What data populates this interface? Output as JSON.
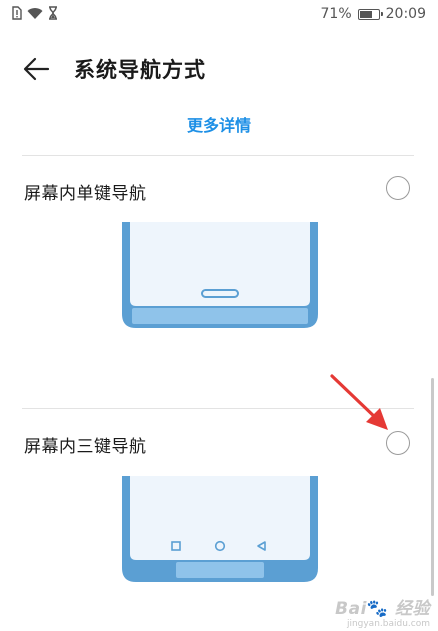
{
  "status_bar": {
    "battery_level": 71,
    "battery_text": "71%",
    "time": "20:09",
    "icons": [
      "sim-alert-icon",
      "wifi-icon",
      "hourglass-icon",
      "battery-icon"
    ]
  },
  "header": {
    "back_icon": "arrow-left-icon",
    "title": "系统导航方式"
  },
  "more_details": "更多详情",
  "options": [
    {
      "label": "屏幕内单键导航",
      "selected": false,
      "style": "single-key-pill"
    },
    {
      "label": "屏幕内三键导航",
      "selected": false,
      "style": "three-keys",
      "keys": [
        "square-icon",
        "circle-icon",
        "triangle-icon"
      ]
    }
  ],
  "colors": {
    "accent": "#1e90e6",
    "phone_frame": "#5b9fd3",
    "phone_screen": "#eef5fc",
    "annotation_arrow": "#e53935"
  },
  "watermark": {
    "main": "Bai 经验",
    "sub": "jingyan.baidu.com"
  }
}
